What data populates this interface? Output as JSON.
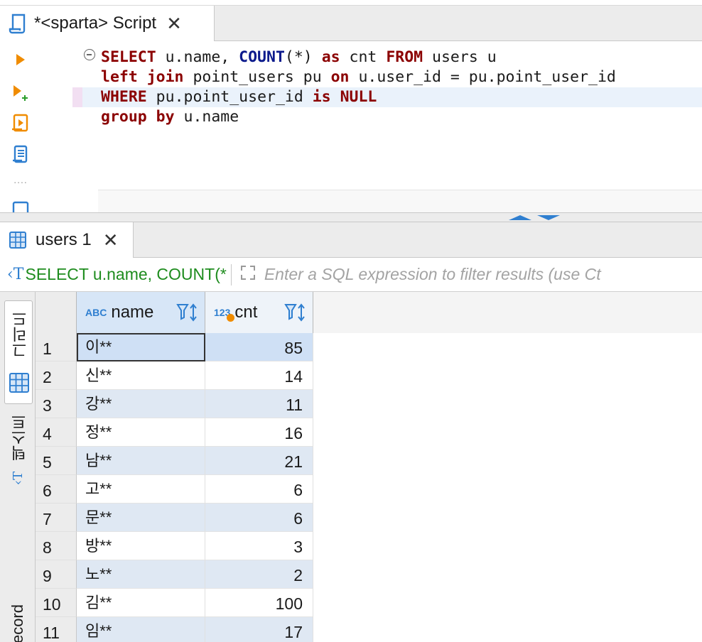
{
  "editor_tab": {
    "title": "*<sparta> Script",
    "close": "✕"
  },
  "code": {
    "line1": {
      "kw1": "SELECT",
      "t1": " u.name, ",
      "fn1": "COUNT",
      "t2": "(*) ",
      "kw2": "as",
      "t3": " cnt ",
      "kw3": "FROM",
      "t4": " users u"
    },
    "line2": {
      "kw1": "left join",
      "t1": " point_users pu ",
      "kw2": "on",
      "t2": " u.user_id = pu.point_user_id"
    },
    "line3": {
      "kw1": "WHERE",
      "t1": " pu.point_user_id ",
      "kw2": "is NULL"
    },
    "line4": {
      "kw1": "group by",
      "t1": " u.name"
    }
  },
  "results_tab": {
    "title": "users 1",
    "close": "✕"
  },
  "filter": {
    "query_icon": "‹T",
    "query_text": "SELECT u.name, COUNT(*",
    "placeholder": "Enter a SQL expression to filter results (use Ct"
  },
  "side_tabs": {
    "grid": "그리드",
    "text": "텍스트",
    "record": "Record"
  },
  "grid": {
    "columns": [
      {
        "type": "ABC",
        "label": "name"
      },
      {
        "type": "123",
        "label": "cnt"
      }
    ],
    "rows": [
      {
        "num": "1",
        "name": "이**",
        "cnt": "85"
      },
      {
        "num": "2",
        "name": "신**",
        "cnt": "14"
      },
      {
        "num": "3",
        "name": "강**",
        "cnt": "11"
      },
      {
        "num": "4",
        "name": "정**",
        "cnt": "16"
      },
      {
        "num": "5",
        "name": "남**",
        "cnt": "21"
      },
      {
        "num": "6",
        "name": "고**",
        "cnt": "6"
      },
      {
        "num": "7",
        "name": "문**",
        "cnt": "6"
      },
      {
        "num": "8",
        "name": "방**",
        "cnt": "3"
      },
      {
        "num": "9",
        "name": "노**",
        "cnt": "2"
      },
      {
        "num": "10",
        "name": "김**",
        "cnt": "100"
      },
      {
        "num": "11",
        "name": "임**",
        "cnt": "17"
      }
    ]
  },
  "colors": {
    "accent": "#2f7fd0",
    "keyword": "#8b0000",
    "function": "#0b1a8c",
    "query_green": "#1e8c1e",
    "run_orange": "#f08c00"
  }
}
